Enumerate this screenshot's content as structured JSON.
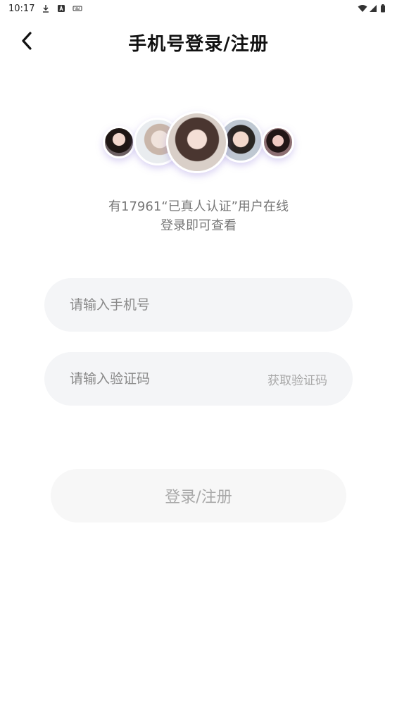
{
  "status_bar": {
    "time": "10:17",
    "left_icons": [
      "download-icon",
      "a-badge-icon",
      "keyboard-icon"
    ],
    "right_icons": [
      "wifi-icon",
      "signal-icon",
      "battery-icon"
    ]
  },
  "header": {
    "back_icon": "chevron-left-icon",
    "title": "手机号登录/注册"
  },
  "avatars": {
    "count": 5
  },
  "info": {
    "line1": "有17961“已真人认证”用户在线",
    "line2": "登录即可查看"
  },
  "form": {
    "phone_placeholder": "请输入手机号",
    "phone_value": "",
    "code_placeholder": "请输入验证码",
    "code_value": "",
    "get_code_label": "获取验证码"
  },
  "submit": {
    "label": "登录/注册"
  },
  "colors": {
    "field_bg": "#f4f5f7",
    "button_bg": "#f7f7f7",
    "placeholder": "#8a8a8a",
    "muted_text": "#a9a9a9",
    "avatar_shadow": "#9682dc"
  }
}
